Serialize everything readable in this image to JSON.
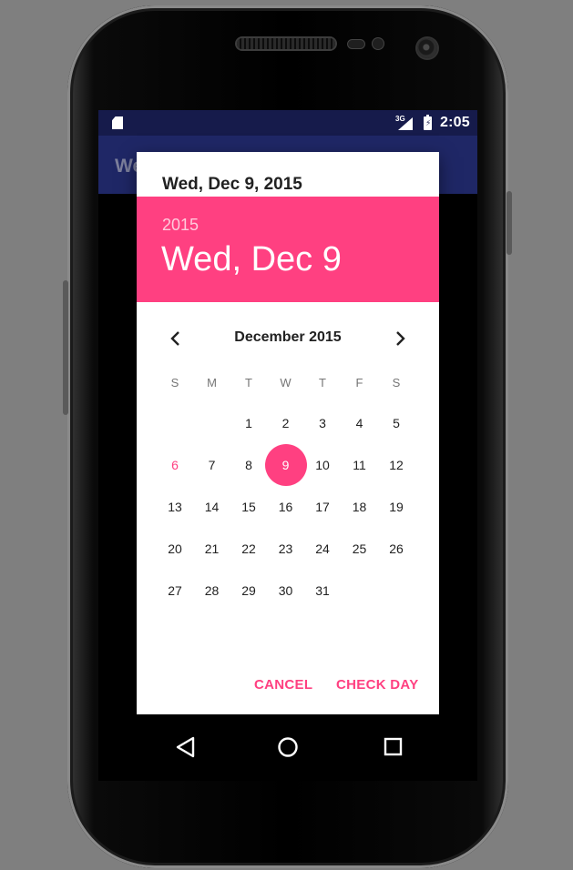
{
  "status_bar": {
    "network_label": "3G",
    "time": "2:05",
    "icons": [
      "sd-card-icon",
      "signal-icon",
      "battery-charging-icon"
    ]
  },
  "app": {
    "title": "We"
  },
  "dialog": {
    "title": "Wed, Dec 9, 2015",
    "header_year": "2015",
    "header_date": "Wed, Dec 9",
    "month_label": "December 2015",
    "weekdays": [
      "S",
      "M",
      "T",
      "W",
      "T",
      "F",
      "S"
    ],
    "weeks": [
      [
        "",
        "",
        "1",
        "2",
        "3",
        "4",
        "5"
      ],
      [
        "6",
        "7",
        "8",
        "9",
        "10",
        "11",
        "12"
      ],
      [
        "13",
        "14",
        "15",
        "16",
        "17",
        "18",
        "19"
      ],
      [
        "20",
        "21",
        "22",
        "23",
        "24",
        "25",
        "26"
      ],
      [
        "27",
        "28",
        "29",
        "30",
        "31",
        "",
        ""
      ]
    ],
    "today": "6",
    "selected": "9",
    "cancel_label": "CANCEL",
    "ok_label": "CHECK DAY",
    "colors": {
      "accent": "#ff4081",
      "primary_dark": "#161b4b",
      "primary": "#1f2766"
    }
  },
  "nav_bar": {
    "icons": [
      "back-icon",
      "home-icon",
      "recents-icon"
    ]
  }
}
